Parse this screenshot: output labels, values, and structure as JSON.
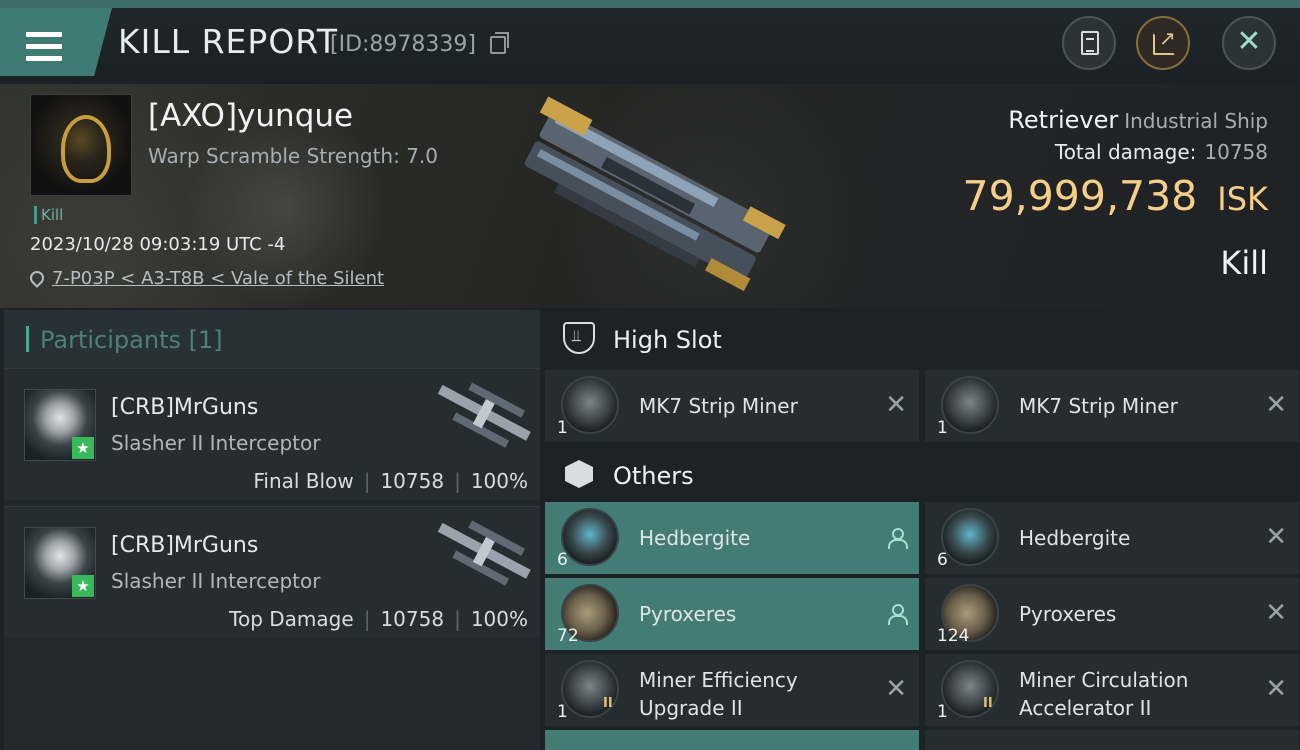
{
  "header": {
    "title": "KILL REPORT",
    "report_id": "[ID:8978339]"
  },
  "victim": {
    "name": "[AXO]yunque",
    "warp_scramble": "Warp Scramble Strength: 7.0",
    "tag": "Kill",
    "datetime": "2023/10/28 09:03:19 UTC -4",
    "location": "7-P03P < A3-T8B < Vale of the Silent",
    "ship_name": "Retriever",
    "ship_class": "Industrial Ship",
    "total_damage_label": "Total damage:",
    "total_damage": "10758",
    "isk_value": "79,999,738",
    "isk_unit": "ISK",
    "result": "Kill"
  },
  "participants": {
    "header": "Participants [1]",
    "items": [
      {
        "name": "[CRB]MrGuns",
        "ship": "Slasher II Interceptor",
        "role": "Final Blow",
        "damage": "10758",
        "percent": "100%"
      },
      {
        "name": "[CRB]MrGuns",
        "ship": "Slasher II Interceptor",
        "role": "Top Damage",
        "damage": "10758",
        "percent": "100%"
      }
    ]
  },
  "loot": {
    "high_slot": {
      "label": "High Slot",
      "items": [
        {
          "name": "MK7 Strip Miner",
          "qty": "1",
          "icon": "strip-miner-icon"
        },
        {
          "name": "MK7 Strip Miner",
          "qty": "1",
          "icon": "strip-miner-icon"
        }
      ]
    },
    "others": {
      "label": "Others",
      "items": [
        {
          "name": "Hedbergite",
          "qty": "6",
          "dropped": true
        },
        {
          "name": "Hedbergite",
          "qty": "6",
          "dropped": false
        },
        {
          "name": "Pyroxeres",
          "qty": "72",
          "dropped": true
        },
        {
          "name": "Pyroxeres",
          "qty": "124",
          "dropped": false
        },
        {
          "name": "Miner Efficiency Upgrade II",
          "qty": "1",
          "tier": "II",
          "dropped": false
        },
        {
          "name": "Miner Circulation Accelerator II",
          "qty": "1",
          "tier": "II",
          "dropped": false
        }
      ]
    }
  },
  "colors": {
    "accent_teal": "#437c74",
    "isk_gold": "#f5cf8a",
    "background": "#1c2226"
  }
}
